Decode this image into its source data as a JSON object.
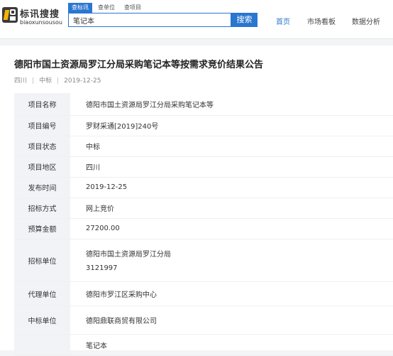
{
  "logo": {
    "title": "标讯搜搜",
    "subtitle": "biaoxunsousou"
  },
  "search": {
    "tabs": [
      "查标讯",
      "查单位",
      "查项目"
    ],
    "active_tab": 0,
    "value": "笔记本",
    "button_label": "搜索"
  },
  "nav": {
    "items": [
      "首页",
      "市场看板",
      "数据分析"
    ],
    "active": 0
  },
  "notice": {
    "title": "德阳市国土资源局罗江分局采购笔记本等按需求竞价结果公告",
    "region": "四川",
    "status": "中标",
    "date": "2019-12-25"
  },
  "details": [
    {
      "label": "项目名称",
      "value": "德阳市国土资源局罗江分局采购笔记本等"
    },
    {
      "label": "项目编号",
      "value": "罗财采通[2019]240号"
    },
    {
      "label": "项目状态",
      "value": "中标"
    },
    {
      "label": "项目地区",
      "value": "四川"
    },
    {
      "label": "发布时间",
      "value": "2019-12-25"
    },
    {
      "label": "招标方式",
      "value": "网上竞价"
    },
    {
      "label": "预算金额",
      "value": "27200.00"
    },
    {
      "label": "招标单位",
      "value": "德阳市国土资源局罗江分局",
      "value2": "3121997"
    },
    {
      "label": "代理单位",
      "value": "德阳市罗江区采购中心"
    },
    {
      "label": "中标单位",
      "value": "德阳鼎联商贸有限公司"
    },
    {
      "label": "",
      "value": "笔记本"
    }
  ],
  "colors": {
    "accent": "#2a76d0",
    "label_bg": "#f2f3f7",
    "page_bg": "#f3f4f6"
  }
}
